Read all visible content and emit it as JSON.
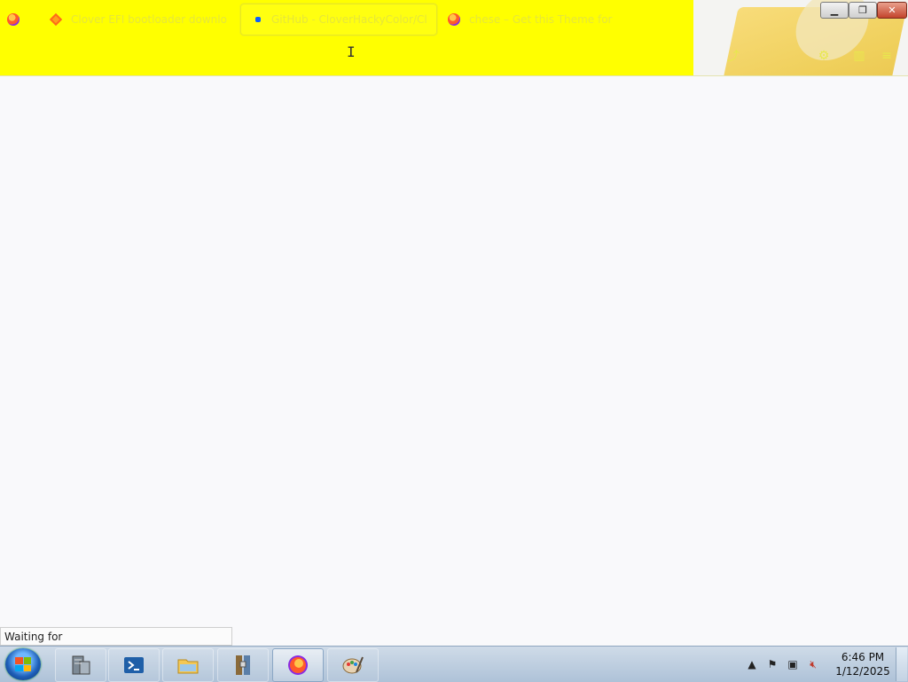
{
  "browser": {
    "tabs": [
      {
        "title": "",
        "icon": "firefox-icon",
        "active": false
      },
      {
        "title": "Clover EFI bootloader downlo…",
        "icon": "clover-diamond-icon",
        "active": false
      },
      {
        "title": "GitHub - CloverHackyColor/Cl",
        "icon": "github-icon",
        "active": true
      },
      {
        "title": "chese – Get this Theme for 🦊 F",
        "icon": "firefox-icon",
        "active": false
      }
    ],
    "theme": {
      "chrome_color": "#ffff00",
      "image": "cheese-theme-image"
    }
  },
  "window_controls": {
    "minimize": "minimize-icon",
    "restore": "restore-icon",
    "close": "close-icon"
  },
  "status": {
    "text": "Waiting for avatars.githubusercontent.com..."
  },
  "taskbar": {
    "apps": [
      {
        "name": "server-manager-icon"
      },
      {
        "name": "powershell-icon"
      },
      {
        "name": "file-explorer-icon"
      },
      {
        "name": "archive-tool-icon"
      },
      {
        "name": "firefox-icon",
        "running": true
      },
      {
        "name": "paint-icon"
      }
    ],
    "clock": {
      "time": "6:46 PM",
      "date": "1/12/2025"
    }
  }
}
